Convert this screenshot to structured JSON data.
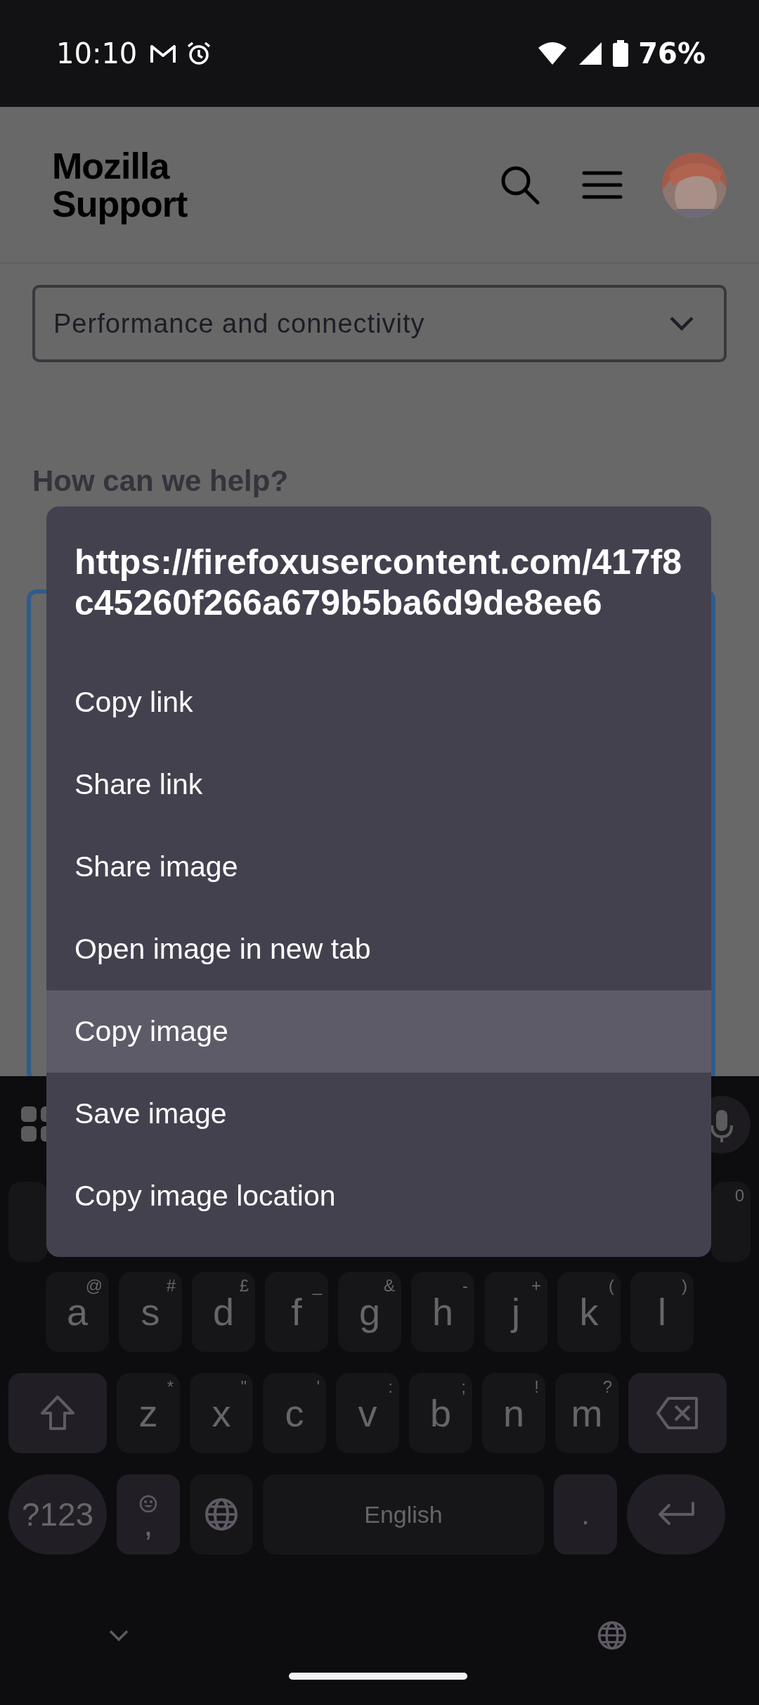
{
  "status_bar": {
    "time": "10:10",
    "battery": "76%"
  },
  "header": {
    "logo_lines": [
      "Mozilla",
      "Support"
    ]
  },
  "topic_select": {
    "value": "Performance and connectivity"
  },
  "heading": "How can we help?",
  "context_menu": {
    "title": "https://firefoxusercontent.com/417f8c45260f266a679b5ba6d9de8ee6",
    "items": [
      {
        "label": "Copy link",
        "selected": false
      },
      {
        "label": "Share link",
        "selected": false
      },
      {
        "label": "Share image",
        "selected": false
      },
      {
        "label": "Open image in new tab",
        "selected": false
      },
      {
        "label": "Copy image",
        "selected": true
      },
      {
        "label": "Save image",
        "selected": false
      },
      {
        "label": "Copy image location",
        "selected": false
      }
    ]
  },
  "keyboard": {
    "top_row_hint": "0",
    "home_row": [
      {
        "label": "a",
        "hint": "@"
      },
      {
        "label": "s",
        "hint": "#"
      },
      {
        "label": "d",
        "hint": "£"
      },
      {
        "label": "f",
        "hint": "_"
      },
      {
        "label": "g",
        "hint": "&"
      },
      {
        "label": "h",
        "hint": "-"
      },
      {
        "label": "j",
        "hint": "+"
      },
      {
        "label": "k",
        "hint": "("
      },
      {
        "label": "l",
        "hint": ")"
      }
    ],
    "lower_row": [
      {
        "label": "z",
        "hint": "*"
      },
      {
        "label": "x",
        "hint": "\""
      },
      {
        "label": "c",
        "hint": "'"
      },
      {
        "label": "v",
        "hint": ":"
      },
      {
        "label": "b",
        "hint": ";"
      },
      {
        "label": "n",
        "hint": "!"
      },
      {
        "label": "m",
        "hint": "?"
      }
    ],
    "symbols_key": "?123",
    "comma_key": ",",
    "space_key": "English",
    "period_key": "."
  }
}
